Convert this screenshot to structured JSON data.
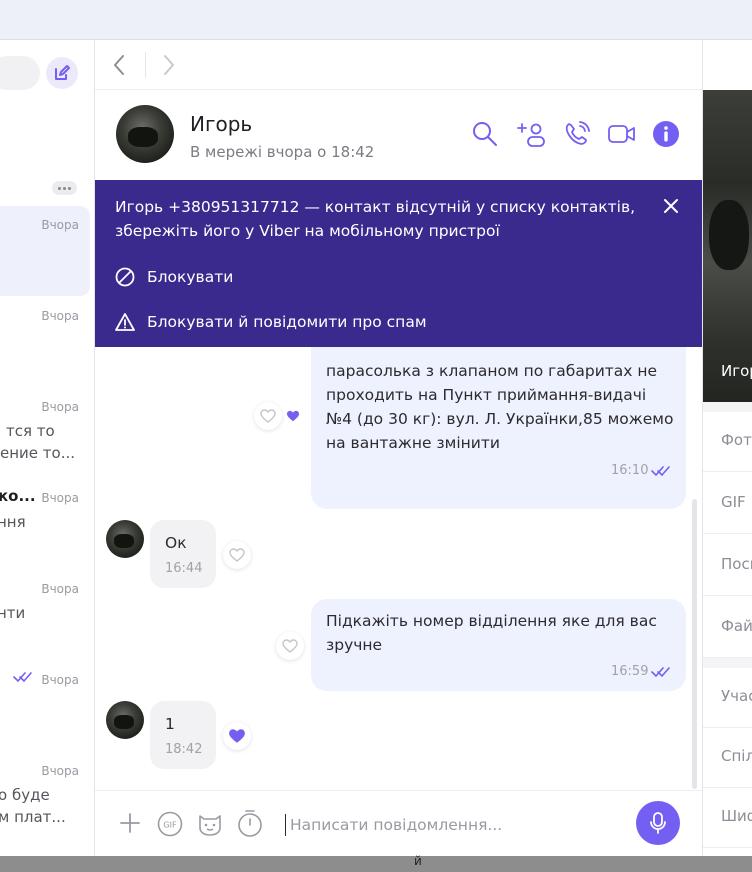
{
  "sidebar": {
    "chats": [
      {
        "time": "Вчора",
        "line1": "",
        "line2": ""
      },
      {
        "time": "Вчора",
        "line1": "",
        "line2": ""
      },
      {
        "time": "Вчора",
        "line1": "тся то",
        "line2": "ение то..."
      },
      {
        "time": "Вчора",
        "line1": "ко...",
        "line2": "ння"
      },
      {
        "time": "Вчора",
        "line1": "нти",
        "line2": ""
      },
      {
        "time": "Вчора",
        "line1": "",
        "line2": ""
      },
      {
        "time": "Вчора",
        "line1": "о буде",
        "line2": "м плат..."
      }
    ]
  },
  "header": {
    "name": "Игорь",
    "status": "В мережі вчора о 18:42"
  },
  "banner": {
    "line1": "Игорь +380951317712 — контакт відсутній у списку контактів,",
    "line2": "збережіть його у Viber на мобільному пристрої",
    "block": "Блокувати",
    "block_spam": "Блокувати й повідомити про спам"
  },
  "messages": [
    {
      "lines": [
        "парасолька з клапаном  по габаритах не",
        "проходить на Пункт приймання-видачі",
        "№4 (до 30 кг): вул. Л. Українки,85 можемо",
        "на вантажне змінити"
      ],
      "time": "16:10"
    },
    {
      "lines": [
        "Ок"
      ],
      "time": "16:44"
    },
    {
      "lines": [
        "Підкажіть номер відділення яке для вас",
        "зручне"
      ],
      "time": "16:59"
    },
    {
      "lines": [
        "1"
      ],
      "time": "18:42"
    }
  ],
  "composer": {
    "placeholder": "Написати повідомлення..."
  },
  "right_panel": {
    "photo_name": "Игорь",
    "items": [
      "Фото",
      "GIF",
      "Посилання",
      "Файли",
      "Учасники",
      "Спільні",
      "Шифрування"
    ]
  },
  "bottom_text": "й",
  "colors": {
    "accent": "#7360f2",
    "banner": "#3b2a8e",
    "bubble_out": "#eef1fe",
    "bubble_in": "#f2f2f4"
  }
}
